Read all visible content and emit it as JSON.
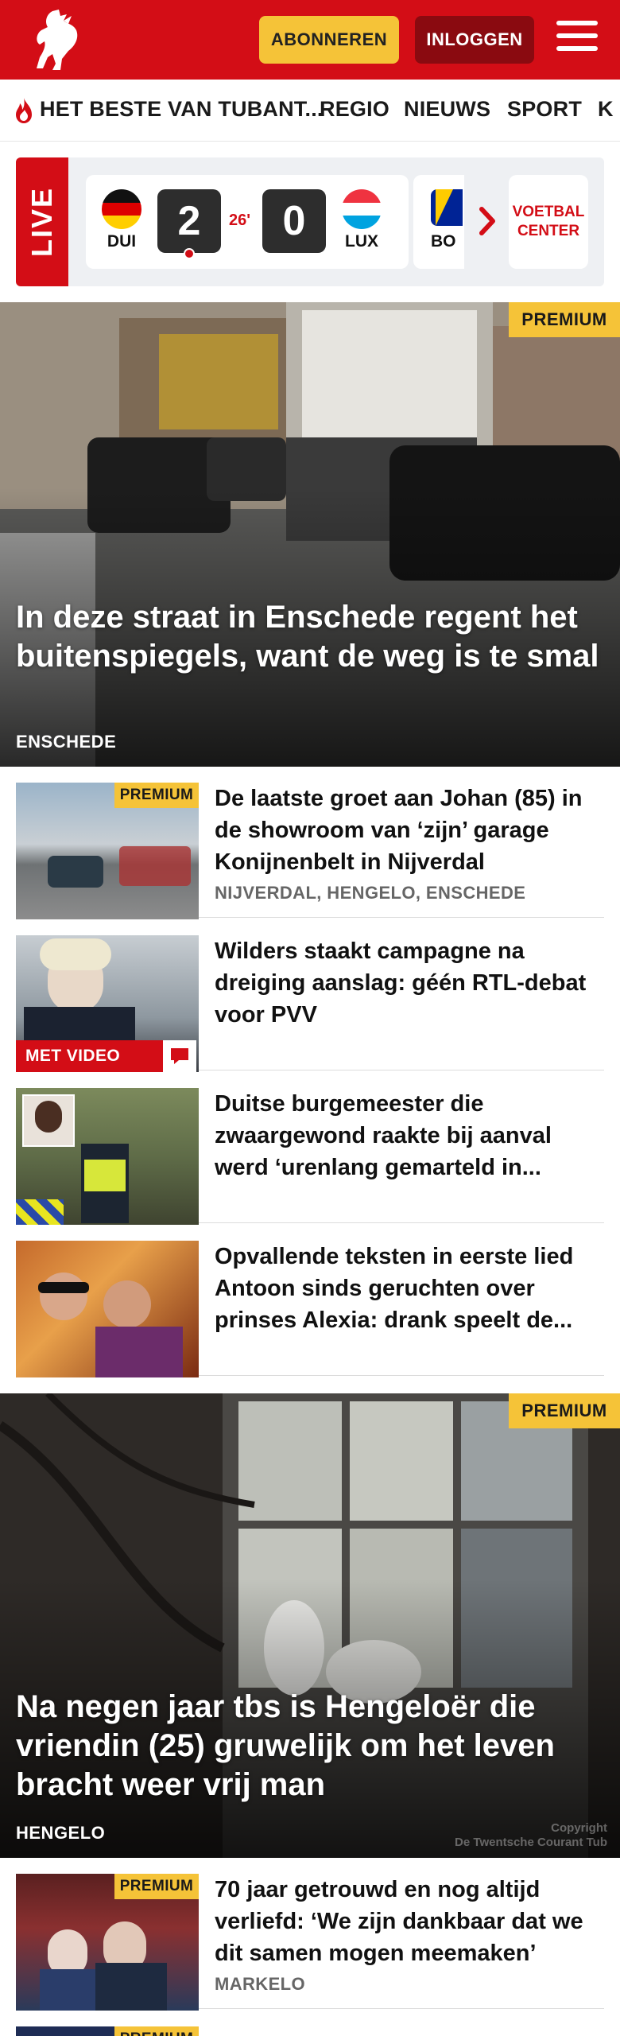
{
  "header": {
    "subscribe_label": "ABONNEREN",
    "login_label": "INLOGGEN",
    "brand_color": "#d30d16"
  },
  "nav": {
    "items": [
      "HET BESTE VAN TUBANT...",
      "REGIO",
      "NIEUWS",
      "SPORT",
      "K"
    ]
  },
  "live": {
    "label": "LIVE",
    "match": {
      "home_team": "DUI",
      "away_team": "LUX",
      "home_score": "2",
      "away_score": "0",
      "minute": "26'"
    },
    "next_team": "BO",
    "voetbal_center": "VOETBAL CENTER"
  },
  "articles": {
    "hero1": {
      "premium": "PREMIUM",
      "title": "In deze straat in Enschede regent het buitenspiegels, want de weg is te smal",
      "location": "ENSCHEDE"
    },
    "list1": [
      {
        "title": "De laatste groet aan Johan (85) in de showroom van ‘zijn’ garage Konijnenbelt in Nijverdal",
        "location": "NIJVERDAL, HENGELO, ENSCHEDE",
        "premium": "PREMIUM"
      },
      {
        "title": "Wilders staakt campagne na dreiging aanslag: géén RTL-debat voor PVV",
        "video_label": "MET VIDEO"
      },
      {
        "title": "Duitse burgemeester die zwaargewond raakte bij aanval werd ‘urenlang gemarteld in..."
      },
      {
        "title": "Opvallende teksten in eerste lied Antoon sinds geruchten over prinses Alexia: drank speelt de..."
      }
    ],
    "hero2": {
      "premium": "PREMIUM",
      "title": "Na negen jaar tbs is Hengeloër die vriendin (25) gruwelijk om het leven bracht weer vrij man",
      "location": "HENGELO",
      "copyright_1": "Copyright",
      "copyright_2": "De Twentsche Courant Tub"
    },
    "list2": [
      {
        "title": "70 jaar getrouwd en nog altijd verliefd: ‘We zijn dankbaar dat we dit samen mogen meemaken’",
        "location": "MARKELO",
        "premium": "PREMIUM"
      },
      {
        "premium": "PREMIUM"
      }
    ]
  }
}
